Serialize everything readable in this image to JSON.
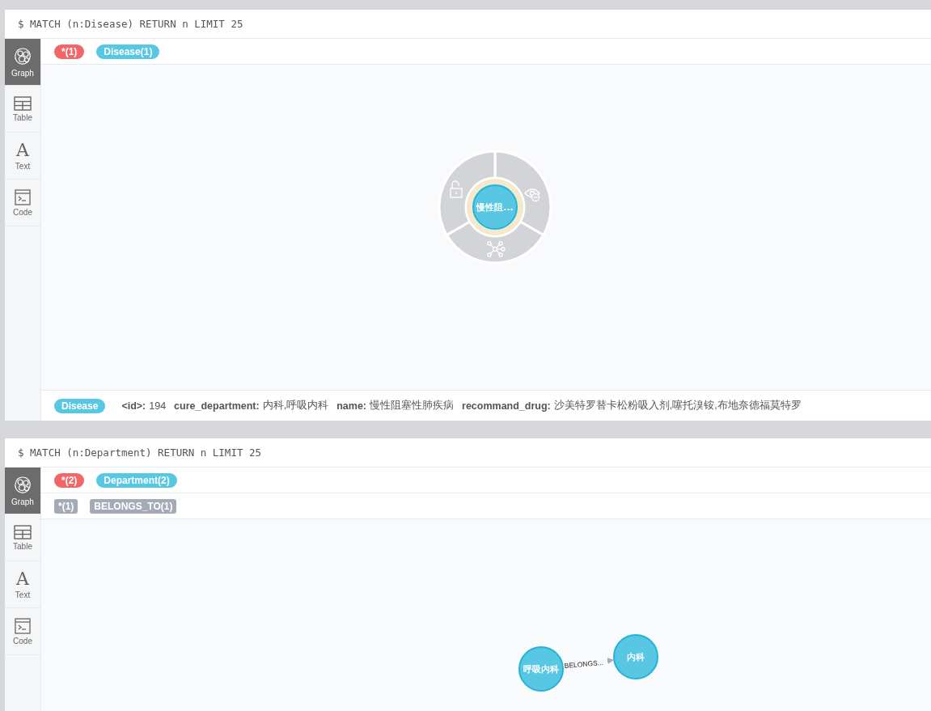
{
  "frames": [
    {
      "query": "$ MATCH (n:Disease) RETURN n LIMIT 25",
      "views": [
        {
          "kind": "graph",
          "label": "Graph",
          "selected": true
        },
        {
          "kind": "table",
          "label": "Table",
          "selected": false
        },
        {
          "kind": "text",
          "label": "Text",
          "glyph": "A",
          "selected": false
        },
        {
          "kind": "code",
          "label": "Code",
          "selected": false
        }
      ],
      "node_labels": [
        {
          "text": "*(1)",
          "color": "#f16667"
        },
        {
          "text": "Disease(1)",
          "color": "#57c7e3"
        }
      ],
      "graph": {
        "kind": "context-menu",
        "nodes": [
          {
            "label": "慢性阻..."
          }
        ]
      },
      "properties": {
        "label": "Disease",
        "items": [
          {
            "key": "<id>:",
            "value": "194"
          },
          {
            "key": "cure_department:",
            "value": "内科,呼吸内科"
          },
          {
            "key": "name:",
            "value": "慢性阻塞性肺疾病"
          },
          {
            "key": "recommand_drug:",
            "value": "沙美特罗替卡松粉吸入剂,噻托溴铵,布地奈德福莫特罗"
          }
        ]
      }
    },
    {
      "query": "$ MATCH (n:Department) RETURN n LIMIT 25",
      "views": [
        {
          "kind": "graph",
          "label": "Graph",
          "selected": true
        },
        {
          "kind": "table",
          "label": "Table",
          "selected": false
        },
        {
          "kind": "text",
          "label": "Text",
          "glyph": "A",
          "selected": false
        },
        {
          "kind": "code",
          "label": "Code",
          "selected": false
        }
      ],
      "node_labels": [
        {
          "text": "*(2)",
          "color": "#f16667"
        },
        {
          "text": "Department(2)",
          "color": "#57c7e3"
        }
      ],
      "relationship_types": [
        "*(1)",
        "BELONGS_TO(1)"
      ],
      "graph": {
        "kind": "relationship",
        "nodes": [
          {
            "label": "呼吸内科"
          },
          {
            "label": "内科"
          }
        ],
        "relationship_label": "BELONGS..."
      }
    }
  ]
}
